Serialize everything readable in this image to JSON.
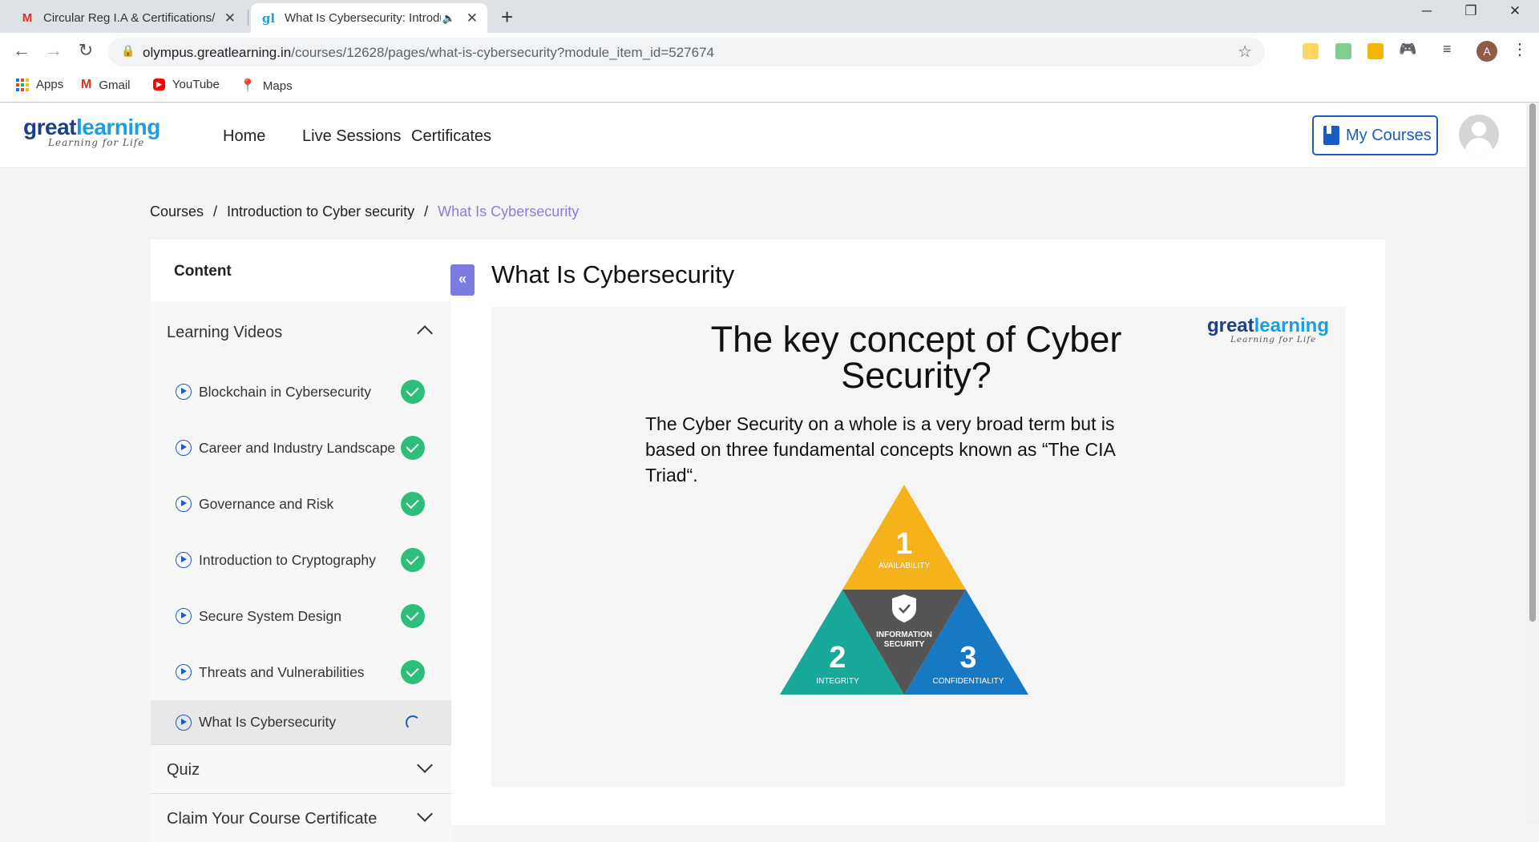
{
  "browser": {
    "tabs": [
      {
        "title": "Circular Reg I.A & Certifications/",
        "favicon": "gmail-icon"
      },
      {
        "title": "What Is Cybersecurity: Introduction",
        "favicon": "greatlearning-icon",
        "audio": true
      }
    ],
    "url_host": "olympus.greatlearning.in",
    "url_path": "/courses/12628/pages/what-is-cybersecurity?module_item_id=527674",
    "profile_initial": "A",
    "bookmarks": [
      {
        "label": "Apps",
        "icon": "apps-grid-icon"
      },
      {
        "label": "Gmail",
        "icon": "gmail-icon"
      },
      {
        "label": "YouTube",
        "icon": "youtube-icon"
      },
      {
        "label": "Maps",
        "icon": "maps-icon"
      }
    ]
  },
  "site": {
    "logo_main_1": "great",
    "logo_main_2": "learning",
    "logo_tagline": "Learning for Life",
    "nav": [
      "Home",
      "Live Sessions",
      "Certificates"
    ],
    "my_courses": "My Courses"
  },
  "breadcrumb": {
    "items": [
      "Courses",
      "Introduction to Cyber security",
      "What Is Cybersecurity"
    ],
    "separator": "/"
  },
  "sidebar": {
    "heading": "Content",
    "section_title": "Learning Videos",
    "items": [
      {
        "label": "Blockchain in Cybersecurity",
        "status": "complete"
      },
      {
        "label": "Career and Industry Landscape",
        "status": "complete"
      },
      {
        "label": "Governance and Risk",
        "status": "complete"
      },
      {
        "label": "Introduction to Cryptography",
        "status": "complete"
      },
      {
        "label": "Secure System Design",
        "status": "complete"
      },
      {
        "label": "Threats and Vulnerabilities",
        "status": "complete"
      },
      {
        "label": "What Is Cybersecurity",
        "status": "loading"
      }
    ],
    "collapsed_sections": [
      "Quiz",
      "Claim Your Course Certificate"
    ],
    "collapse_icon": "«"
  },
  "main": {
    "title": "What Is Cybersecurity",
    "slide": {
      "title": "The key concept of Cyber Security?",
      "text": "The Cyber Security on a whole is a very broad term but is based on three fundamental concepts known as “The CIA Triad“.",
      "logo_main_1": "great",
      "logo_main_2": "learning",
      "logo_tagline": "Learning for Life",
      "triad": {
        "top_number": "1",
        "top_label": "AVAILABILITY",
        "left_number": "2",
        "left_label": "INTEGRITY",
        "right_number": "3",
        "right_label": "CONFIDENTIALITY",
        "center_label_1": "INFORMATION",
        "center_label_2": "SECURITY"
      }
    }
  },
  "colors": {
    "accent_blue": "#1a5cc4",
    "breadcrumb_current": "#8a7ee0",
    "check_green": "#2dbe7a",
    "triad_yellow": "#f6b21b",
    "triad_teal": "#17a89a",
    "triad_blue": "#1779c4",
    "triad_gray": "#555555"
  }
}
